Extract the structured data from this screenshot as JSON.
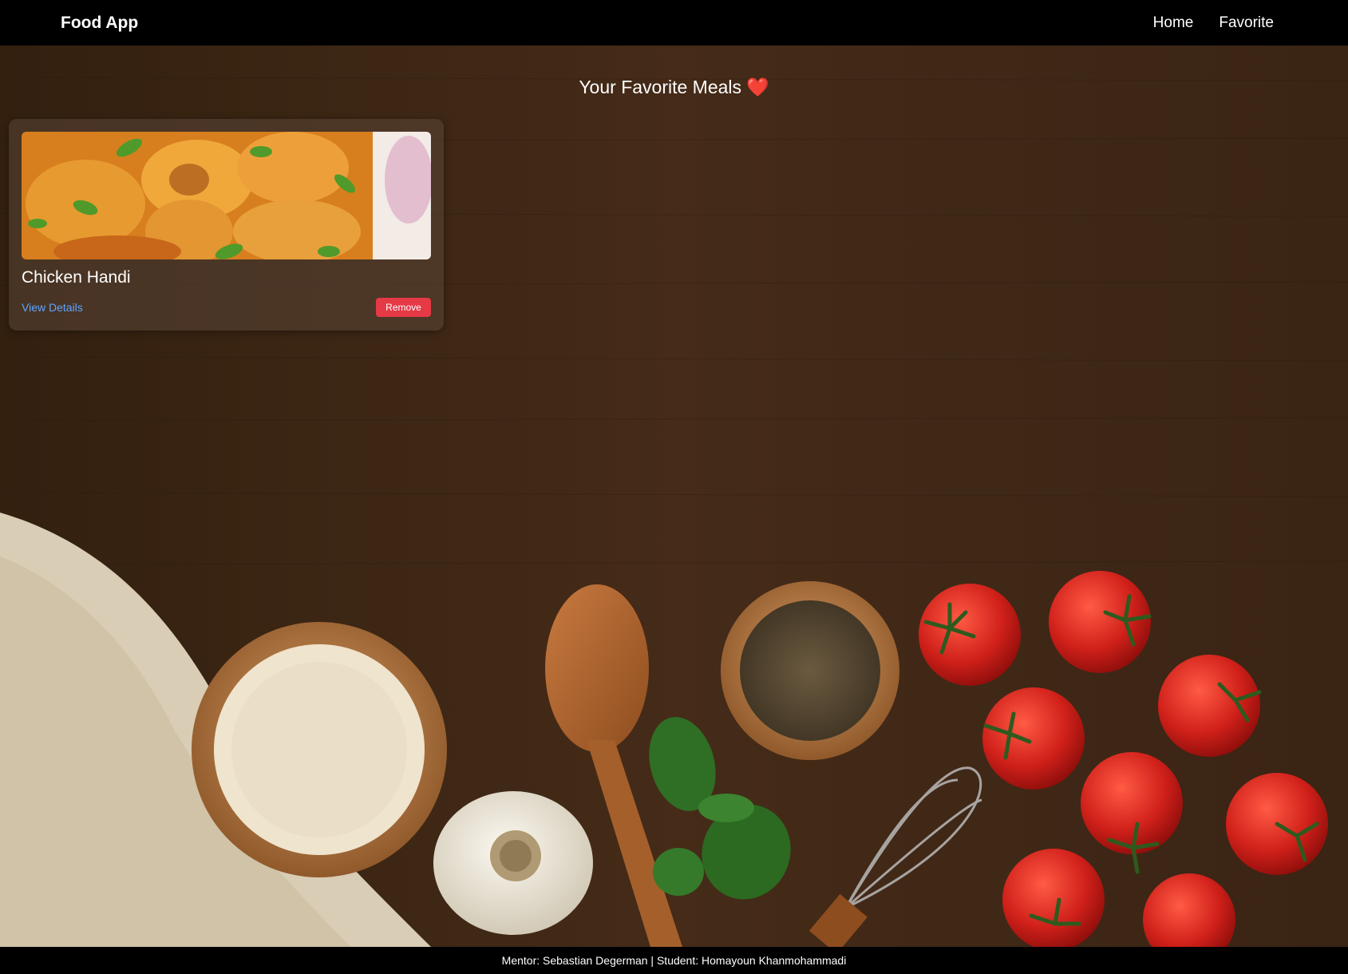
{
  "navbar": {
    "brand": "Food App",
    "links": [
      "Home",
      "Favorite"
    ]
  },
  "page": {
    "title": "Your Favorite Meals",
    "title_emoji": "❤️"
  },
  "favorites": [
    {
      "name": "Chicken Handi",
      "details_label": "View Details",
      "remove_label": "Remove"
    }
  ],
  "footer": {
    "text": "Mentor: Sebastian Degerman | Student: Homayoun Khanmohammadi"
  },
  "colors": {
    "navbar_bg": "#000000",
    "link_blue": "#5ea4ff",
    "remove_red": "#e53945",
    "wood": "#3b2617"
  }
}
